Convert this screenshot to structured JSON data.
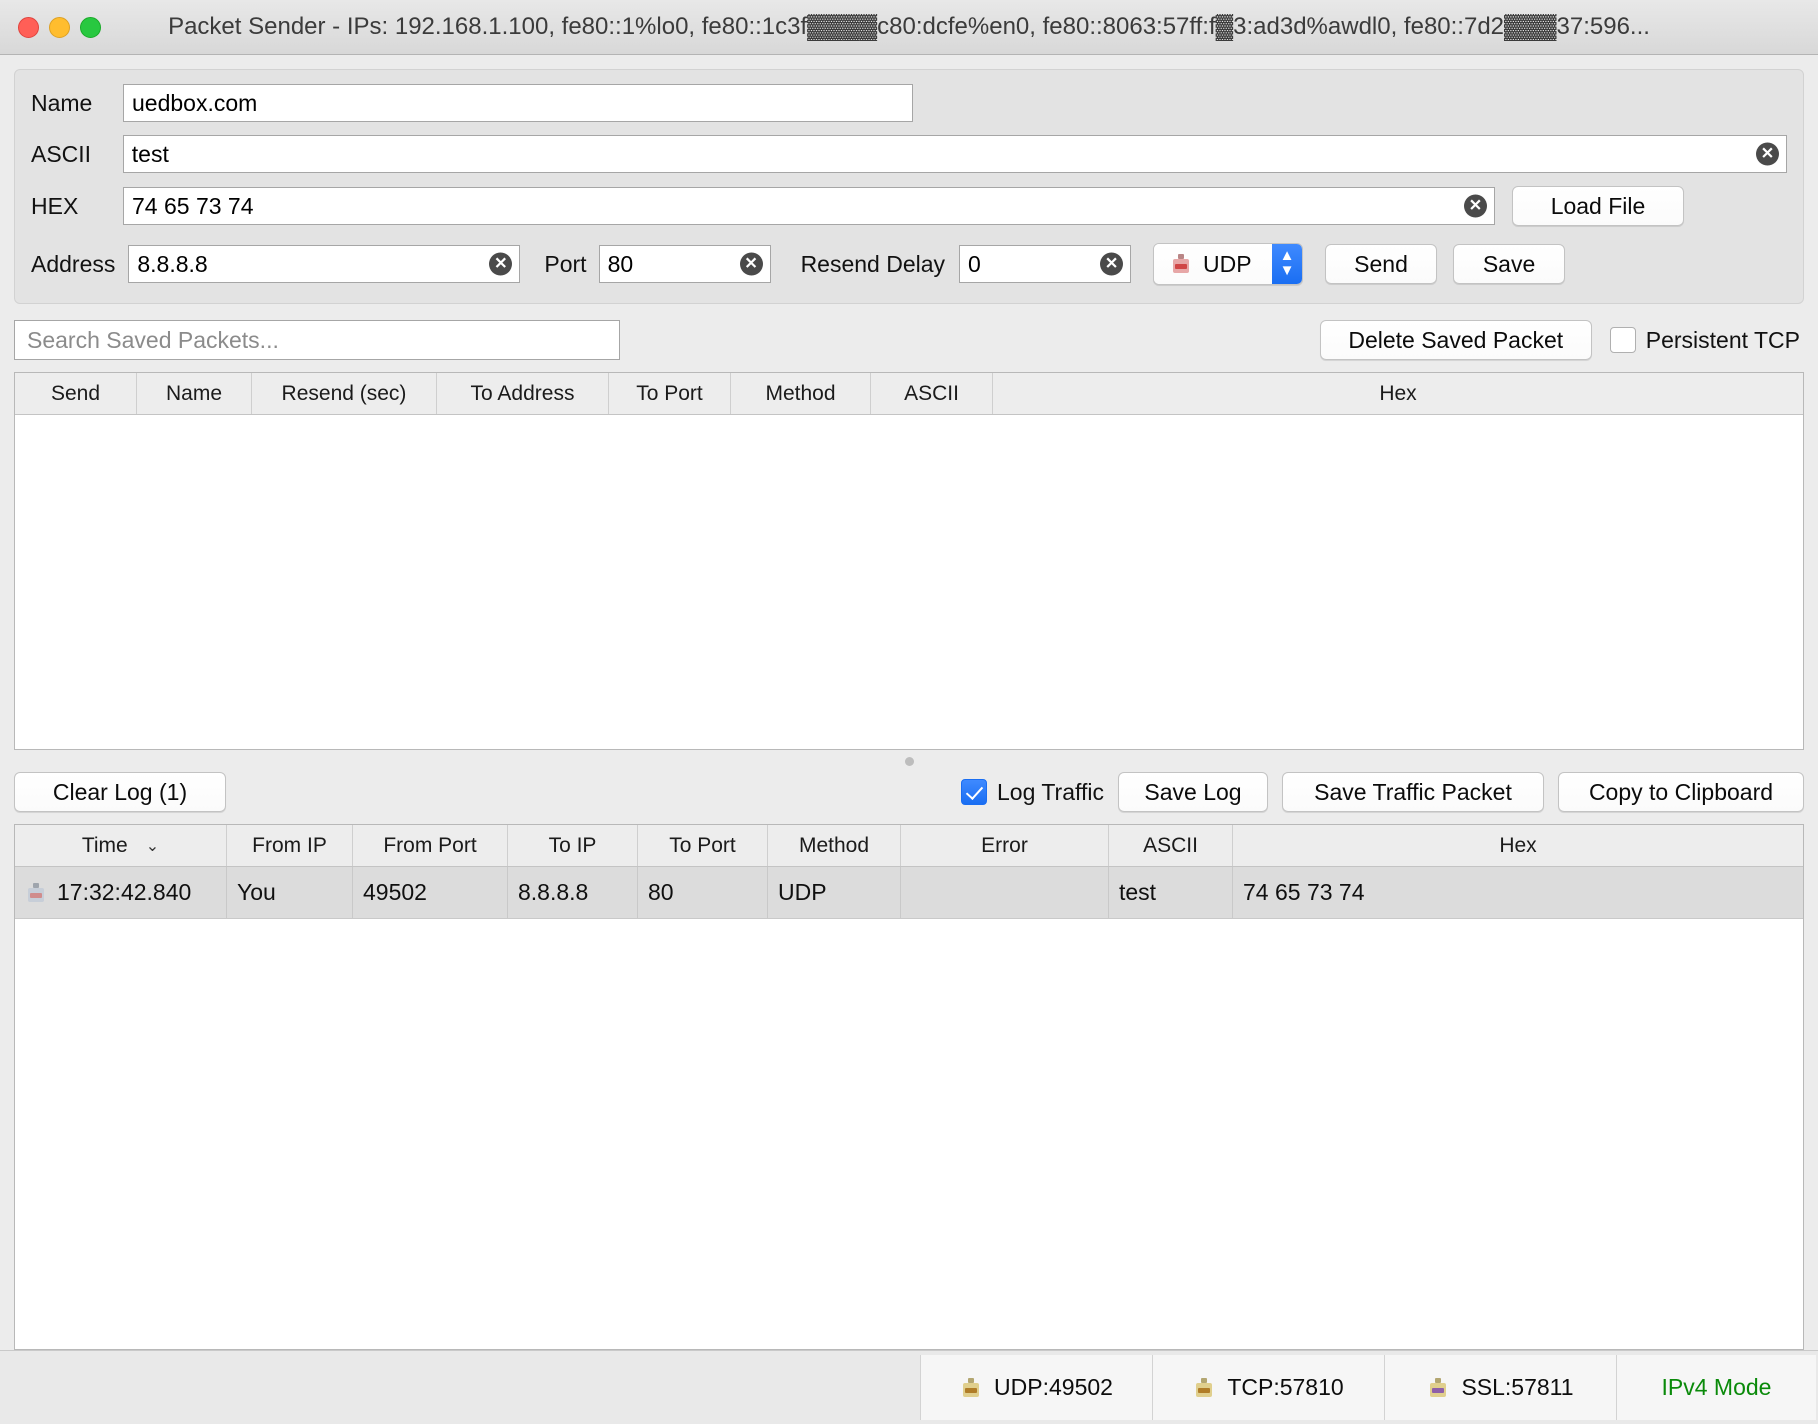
{
  "window": {
    "title": "Packet Sender - IPs: 192.168.1.100, fe80::1%lo0, fe80::1c3f▓▓▓▓c80:dcfe%en0, fe80::8063:57ff:f▓3:ad3d%awdl0, fe80::7d2▓▓▓37:596...",
    "close_tooltip": "Close",
    "minimize_tooltip": "Minimize",
    "zoom_tooltip": "Zoom"
  },
  "form": {
    "name_label": "Name",
    "name_value": "uedbox.com",
    "ascii_label": "ASCII",
    "ascii_value": "test",
    "hex_label": "HEX",
    "hex_value": "74 65 73 74",
    "load_file_label": "Load File",
    "address_label": "Address",
    "address_value": "8.8.8.8",
    "port_label": "Port",
    "port_value": "80",
    "resend_label": "Resend Delay",
    "resend_value": "0",
    "protocol_value": "UDP",
    "protocol_icon": "udp-packet-icon",
    "send_label": "Send",
    "save_label": "Save",
    "clear_glyph": "✕"
  },
  "search": {
    "placeholder": "Search Saved Packets...",
    "value": "",
    "delete_saved_label": "Delete Saved Packet",
    "persistent_tcp_label": "Persistent TCP",
    "persistent_tcp_checked": false
  },
  "saved_table": {
    "columns": [
      "Send",
      "Name",
      "Resend (sec)",
      "To Address",
      "To Port",
      "Method",
      "ASCII",
      "Hex"
    ],
    "rows": []
  },
  "log_toolbar": {
    "clear_log_label": "Clear Log (1)",
    "log_traffic_label": "Log Traffic",
    "log_traffic_checked": true,
    "save_log_label": "Save Log",
    "save_traffic_packet_label": "Save Traffic Packet",
    "copy_to_clipboard_label": "Copy to Clipboard"
  },
  "traffic_table": {
    "columns": [
      "Time",
      "From IP",
      "From Port",
      "To IP",
      "To Port",
      "Method",
      "Error",
      "ASCII",
      "Hex"
    ],
    "sort_column": "Time",
    "sort_caret": "⌄",
    "rows": [
      {
        "icon": "udp-packet-icon",
        "time": "17:32:42.840",
        "from_ip": "You",
        "from_port": "49502",
        "to_ip": "8.8.8.8",
        "to_port": "80",
        "method": "UDP",
        "error": "",
        "ascii": "test",
        "hex": "74 65 73 74"
      }
    ]
  },
  "statusbar": {
    "udp_label": "UDP:49502",
    "tcp_label": "TCP:57810",
    "ssl_label": "SSL:57811",
    "mode_label": "IPv4 Mode",
    "mode_color": "#0a8a0a"
  }
}
